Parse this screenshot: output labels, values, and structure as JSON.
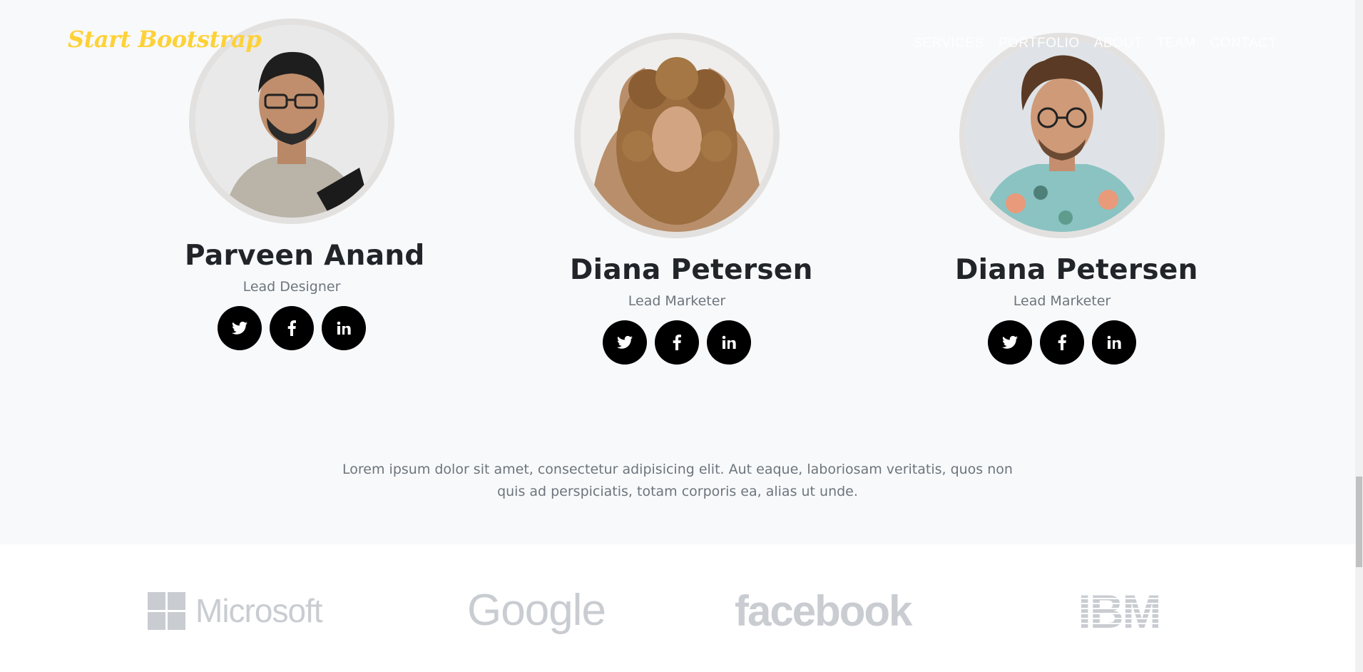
{
  "navbar": {
    "brand": "Start Bootstrap",
    "links": [
      "SERVICES",
      "PORTFOLIO",
      "ABOUT",
      "TEAM",
      "CONTACT"
    ]
  },
  "team": {
    "members": [
      {
        "name": "Parveen Anand",
        "role": "Lead Designer",
        "photo_icon": "person-photo-glasses-shirt"
      },
      {
        "name": "Diana Petersen",
        "role": "Lead Marketer",
        "photo_icon": "person-photo-curly-hair"
      },
      {
        "name": "Diana Petersen",
        "role": "Lead Marketer",
        "photo_icon": "person-photo-floral-shirt"
      }
    ],
    "social_icons": [
      "twitter-icon",
      "facebook-icon",
      "linkedin-icon"
    ],
    "lead_text": "Lorem ipsum dolor sit amet, consectetur adipisicing elit. Aut eaque, laboriosam veritatis, quos non quis ad perspiciatis, totam corporis ea, alias ut unde."
  },
  "clients": {
    "logos": [
      {
        "name": "microsoft-logo",
        "text": "Microsoft"
      },
      {
        "name": "google-logo",
        "text": "Google"
      },
      {
        "name": "facebook-logo",
        "text": "facebook"
      },
      {
        "name": "ibm-logo",
        "text": "IBM"
      }
    ]
  },
  "colors": {
    "brand": "#fed136",
    "section_bg": "#f8f9fa",
    "social_bg": "#000000",
    "muted_text": "#6c757d",
    "logo_gray": "#c9ccd1"
  }
}
